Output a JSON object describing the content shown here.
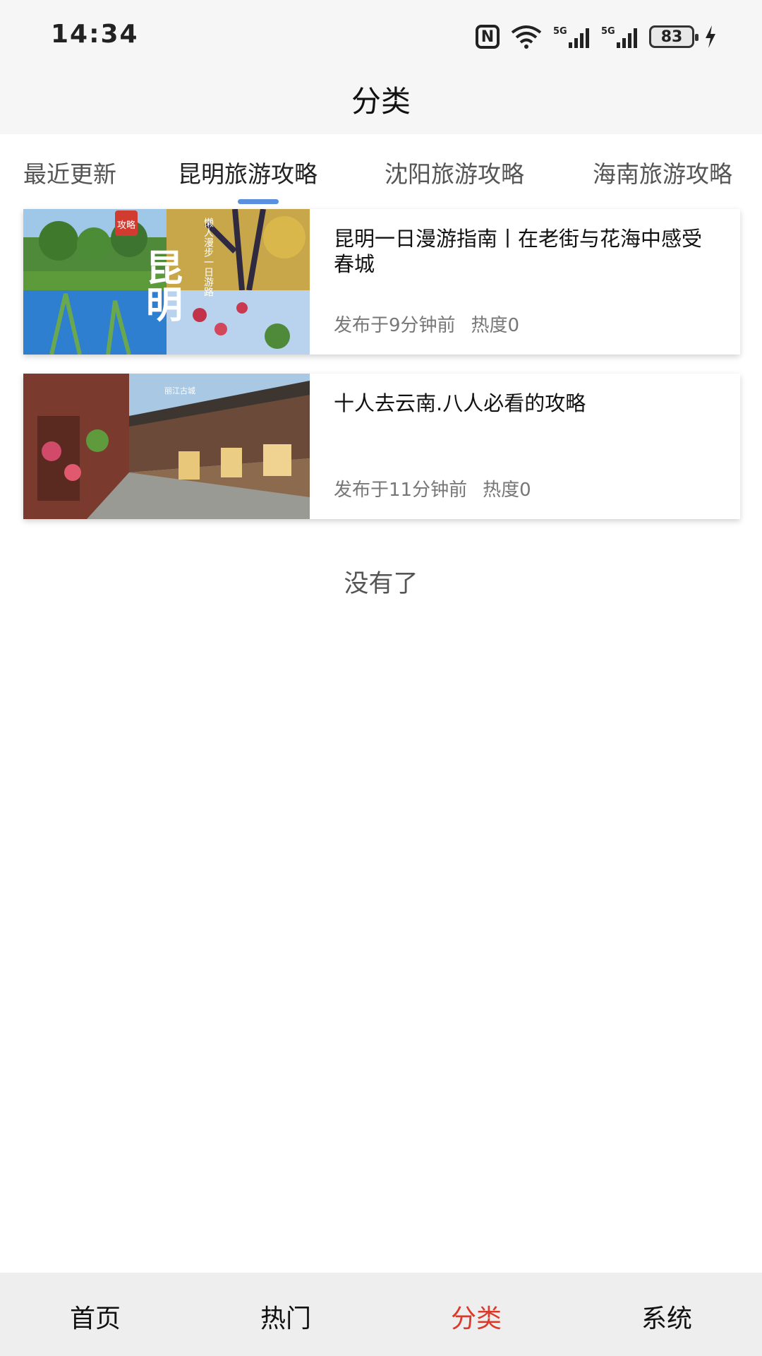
{
  "status_bar": {
    "time": "14:34",
    "battery": "83",
    "network_1": "5G",
    "network_2": "5G",
    "icons": [
      "nfc-icon",
      "wifi-icon",
      "signal-icon",
      "signal-icon",
      "battery-icon",
      "charging-icon"
    ]
  },
  "header": {
    "title": "分类"
  },
  "tabs": [
    {
      "label": "最近更新",
      "active": false
    },
    {
      "label": "昆明旅游攻略",
      "active": true
    },
    {
      "label": "沈阳旅游攻略",
      "active": false
    },
    {
      "label": "海南旅游攻略",
      "active": false
    }
  ],
  "articles": [
    {
      "title": "昆明一日漫游指南丨在老街与花海中感受春城",
      "published": "发布于9分钟前",
      "heat": "热度0",
      "thumb_text": {
        "badge": "攻略",
        "big": "昆明",
        "side": "懒人漫步一日游路"
      }
    },
    {
      "title": "十人去云南.八人必看的攻略",
      "published": "发布于11分钟前",
      "heat": "热度0",
      "thumb_text": {
        "sign": "丽江古城"
      }
    }
  ],
  "list_end_text": "没有了",
  "bottom_nav": [
    {
      "label": "首页",
      "active": false
    },
    {
      "label": "热门",
      "active": false
    },
    {
      "label": "分类",
      "active": true
    },
    {
      "label": "系统",
      "active": false
    }
  ],
  "colors": {
    "accent": "#d93a2b",
    "tab_indicator": "#5b8fe0",
    "bar_bg": "#f6f6f6",
    "nav_bg": "#eeeeee"
  }
}
